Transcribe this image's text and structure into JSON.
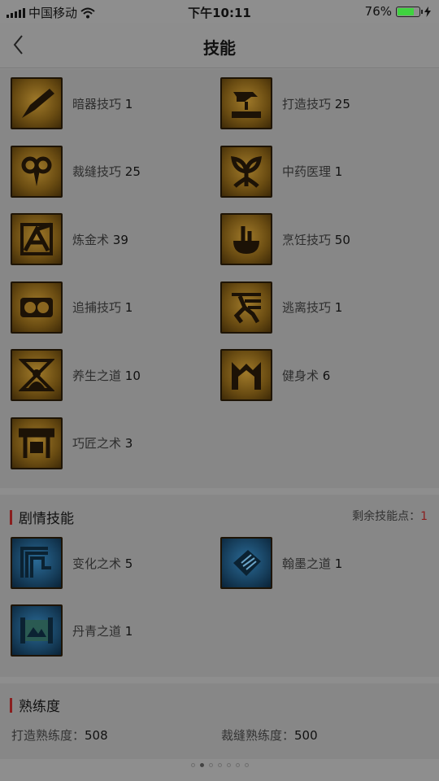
{
  "status_bar": {
    "carrier": "中国移动",
    "time": "下午10:11",
    "battery": "76%",
    "battery_level": 0.76
  },
  "nav": {
    "title": "技能"
  },
  "skills": [
    {
      "name": "暗器技巧",
      "level": "1",
      "icon": "dart-icon"
    },
    {
      "name": "打造技巧",
      "level": "25",
      "icon": "hammer-icon"
    },
    {
      "name": "裁缝技巧",
      "level": "25",
      "icon": "scissors-icon"
    },
    {
      "name": "中药医理",
      "level": "1",
      "icon": "herb-icon"
    },
    {
      "name": "炼金术",
      "level": "39",
      "icon": "alchemy-icon"
    },
    {
      "name": "烹饪技巧",
      "level": "50",
      "icon": "cooking-pot-icon"
    },
    {
      "name": "追捕技巧",
      "level": "1",
      "icon": "shackle-icon"
    },
    {
      "name": "逃离技巧",
      "level": "1",
      "icon": "running-man-icon"
    },
    {
      "name": "养生之道",
      "level": "10",
      "icon": "meditation-icon"
    },
    {
      "name": "健身术",
      "level": "6",
      "icon": "fitness-icon"
    },
    {
      "name": "巧匠之术",
      "level": "3",
      "icon": "workbench-icon"
    }
  ],
  "story_section": {
    "title": "剧情技能",
    "points_label": "剩余技能点：",
    "points_value": "1",
    "skills": [
      {
        "name": "变化之术",
        "level": "5",
        "icon": "transform-icon"
      },
      {
        "name": "翰墨之道",
        "level": "1",
        "icon": "book-icon"
      },
      {
        "name": "丹青之道",
        "level": "1",
        "icon": "scroll-painting-icon"
      }
    ]
  },
  "proficiency": {
    "title": "熟练度",
    "items": [
      {
        "label": "打造熟练度：",
        "value": "508"
      },
      {
        "label": "裁缝熟练度：",
        "value": "500"
      }
    ]
  },
  "pager": {
    "count": 7,
    "active": 1
  },
  "colors": {
    "accent_red": "#8a1e1e",
    "battery_green": "#3fd33f"
  }
}
